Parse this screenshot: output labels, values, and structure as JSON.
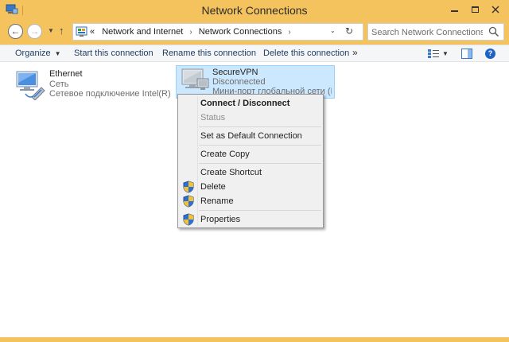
{
  "window": {
    "title": "Network Connections"
  },
  "nav": {
    "back_glyph": "←",
    "forward_glyph": "→",
    "recent_glyph": "▼",
    "up_glyph": "↑"
  },
  "address": {
    "overflow": "«",
    "crumbs": [
      "Network and Internet",
      "Network Connections"
    ],
    "crumb_sep": "›",
    "dropdown_glyph": "⌄",
    "refresh_glyph": "↻"
  },
  "search": {
    "placeholder": "Search Network Connections"
  },
  "toolbar": {
    "organize": "Organize",
    "organize_caret": "▼",
    "start": "Start this connection",
    "rename": "Rename this connection",
    "delete": "Delete this connection",
    "more": "»",
    "view_dd": "▼",
    "help": "?"
  },
  "connections": [
    {
      "name": "Ethernet",
      "status": "Сеть",
      "device": "Сетевое подключение Intel(R) P..."
    },
    {
      "name": "SecureVPN",
      "status": "Disconnected",
      "device": "Мини-порт глобальной сети (IK..."
    }
  ],
  "context_menu": {
    "items": [
      {
        "label": "Connect / Disconnect",
        "bold": true
      },
      {
        "label": "Status",
        "disabled": true
      },
      {
        "label": "Set as Default Connection"
      },
      {
        "label": "Create Copy"
      },
      {
        "label": "Create Shortcut"
      },
      {
        "label": "Delete",
        "shield": true
      },
      {
        "label": "Rename",
        "shield": true
      },
      {
        "label": "Properties",
        "shield": true
      }
    ]
  },
  "colors": {
    "frame": "#f5c35e",
    "selection": "#cce8ff",
    "selection_border": "#99d1ff",
    "link_text": "#1e3a5f"
  }
}
